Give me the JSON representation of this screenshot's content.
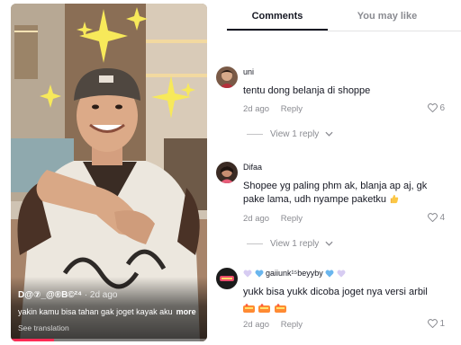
{
  "video": {
    "author": "D@⑦_@®B©²⁴",
    "age": "· 2d ago",
    "caption": "yakin kamu bisa tahan gak joget kayak aku",
    "more_label": "more",
    "see_translation": "See translation",
    "progress_fraction": 0.22
  },
  "tabs": {
    "comments": "Comments",
    "you_may_like": "You may like"
  },
  "comments": [
    {
      "username": "uni",
      "text": "tentu dong belanja di shoppe",
      "time": "2d ago",
      "reply_label": "Reply",
      "likes": "6",
      "view_replies": "View 1 reply"
    },
    {
      "username": "Difaa",
      "text": "Shopee yg paling phm ak, blanja ap aj, gk pake lama, udh nyampe paketku",
      "time": "2d ago",
      "reply_label": "Reply",
      "likes": "4",
      "view_replies": "View 1 reply"
    },
    {
      "username": "gaiiunk¹⁵beyyby",
      "text": "yukk bisa yukk dicoba joget nya versi arbil",
      "time": "2d ago",
      "reply_label": "Reply",
      "likes": "1"
    }
  ],
  "colors": {
    "accent": "#fe2c55",
    "text_primary": "#161823",
    "text_secondary": "#8a8b91"
  },
  "icons": {
    "like": "heart-outline-icon",
    "expand": "chevron-down-icon"
  }
}
